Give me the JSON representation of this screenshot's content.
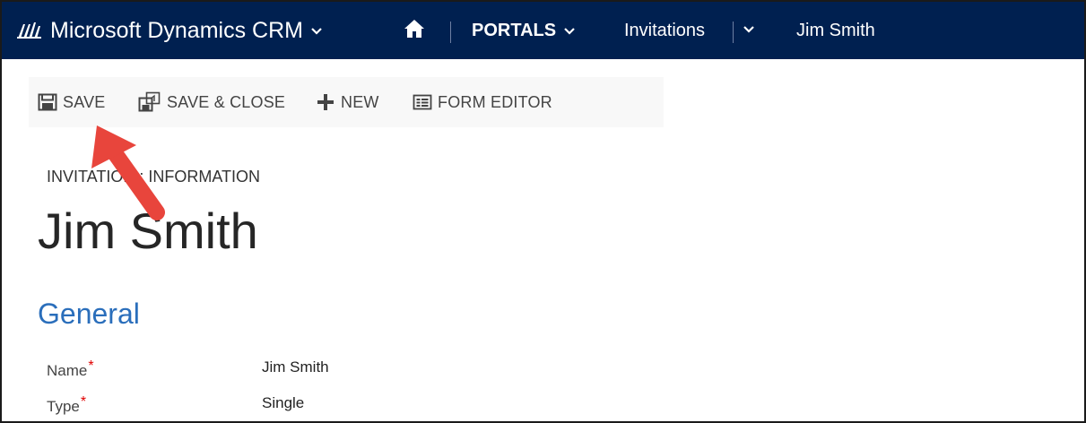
{
  "app": {
    "title": "Microsoft Dynamics CRM",
    "area": "PORTALS",
    "entity": "Invitations",
    "record": "Jim Smith"
  },
  "toolbar": {
    "save_label": "SAVE",
    "save_close_label": "SAVE & CLOSE",
    "new_label": "NEW",
    "form_editor_label": "FORM EDITOR"
  },
  "form": {
    "entity_form_label": "INVITATION : INFORMATION",
    "record_title": "Jim Smith",
    "section_title": "General",
    "fields": [
      {
        "label": "Name",
        "required_marker": "*",
        "value": "Jim Smith"
      },
      {
        "label": "Type",
        "required_marker": "*",
        "value": "Single"
      }
    ]
  },
  "colors": {
    "navbar": "#002050",
    "accent": "#2a6ebb",
    "required": "#e00000",
    "annotation_arrow": "#e8453c"
  },
  "icons": [
    "dynamics-logo-icon",
    "chevron-down-icon",
    "home-icon",
    "save-icon",
    "save-close-icon",
    "plus-icon",
    "form-editor-icon"
  ]
}
